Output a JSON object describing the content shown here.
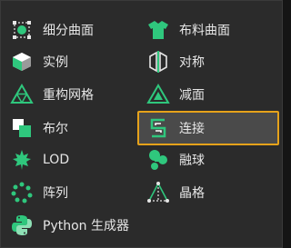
{
  "menu": {
    "left": [
      {
        "label": "细分曲面",
        "icon": "subdivision-surface-icon"
      },
      {
        "label": "实例",
        "icon": "instance-icon"
      },
      {
        "label": "重构网格",
        "icon": "remesh-icon"
      },
      {
        "label": "布尔",
        "icon": "boolean-icon"
      },
      {
        "label": "LOD",
        "icon": "lod-icon"
      },
      {
        "label": "阵列",
        "icon": "array-icon"
      },
      {
        "label": "Python 生成器",
        "icon": "python-generator-icon"
      }
    ],
    "right": [
      {
        "label": "布料曲面",
        "icon": "cloth-surface-icon"
      },
      {
        "label": "对称",
        "icon": "symmetry-icon"
      },
      {
        "label": "减面",
        "icon": "polygon-reduction-icon"
      },
      {
        "label": "连接",
        "icon": "connect-icon",
        "selected": true
      },
      {
        "label": "融球",
        "icon": "metaball-icon"
      },
      {
        "label": "晶格",
        "icon": "lattice-icon"
      }
    ]
  },
  "colors": {
    "icon_green": "#2fc77d",
    "selection_border": "#e6a21a",
    "selection_bg": "#4a4a4a",
    "panel_bg": "#2b2b2b",
    "text": "#e6e6e6"
  }
}
